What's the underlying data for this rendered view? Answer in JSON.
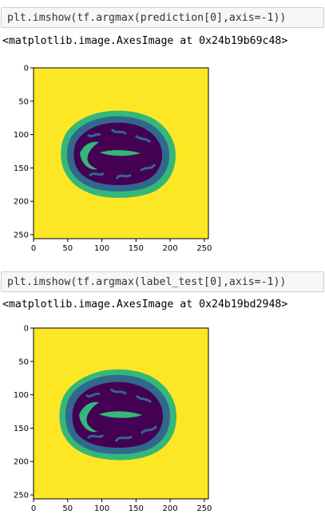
{
  "cells": [
    {
      "input_code": "plt.imshow(tf.argmax(prediction[0],axis=-1))",
      "output_text": "<matplotlib.image.AxesImage at 0x24b19b69c48>",
      "image": {
        "x_ticks": [
          "0",
          "50",
          "100",
          "150",
          "200",
          "250"
        ],
        "y_ticks": [
          "0",
          "50",
          "100",
          "150",
          "200",
          "250"
        ],
        "xlim": [
          0,
          256
        ],
        "ylim": [
          0,
          256
        ],
        "colormap": [
          "#440154",
          "#31688e",
          "#35b779",
          "#fde725"
        ],
        "background_color": "#fde725"
      }
    },
    {
      "input_code": "plt.imshow(tf.argmax(label_test[0],axis=-1))",
      "output_text": "<matplotlib.image.AxesImage at 0x24b19bd2948>",
      "image": {
        "x_ticks": [
          "0",
          "50",
          "100",
          "150",
          "200",
          "250"
        ],
        "y_ticks": [
          "0",
          "50",
          "100",
          "150",
          "200",
          "250"
        ],
        "xlim": [
          0,
          256
        ],
        "ylim": [
          0,
          256
        ],
        "colormap": [
          "#440154",
          "#31688e",
          "#35b779",
          "#fde725"
        ],
        "background_color": "#fde725"
      }
    }
  ]
}
